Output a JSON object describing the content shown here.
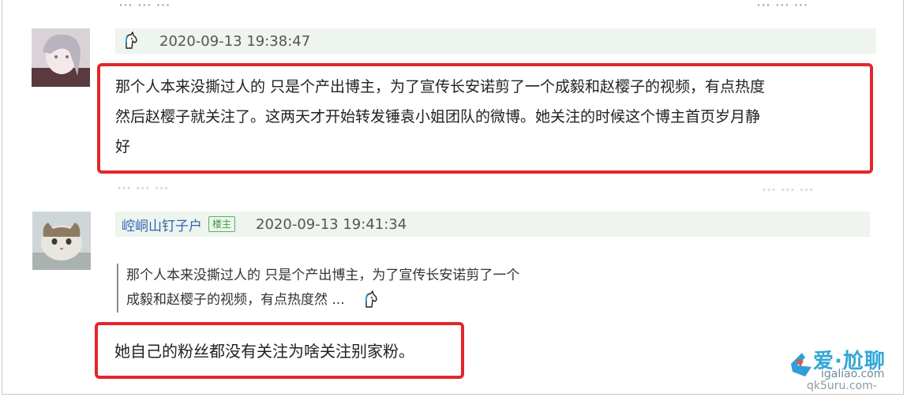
{
  "colors": {
    "accent_red": "#e3262b",
    "username_blue": "#2d64b3",
    "header_bg": "#eef4ee",
    "badge_green": "#3f9a3f"
  },
  "comment1": {
    "time": "2020-09-13 19:38:47",
    "text_lines": [
      "那个人本来没撕过人的 只是个产出博主，为了宣传长安诺剪了一个成毅和赵樱子的视频，有点热度",
      "然后赵樱子就关注了。这两天才开始转发锤袁小姐团队的微博。她关注的时候这个博主首页岁月静",
      "好"
    ],
    "emoji_icon": "unicorn-icon"
  },
  "comment2": {
    "username": "崆峒山钉子户",
    "badge": "楼主",
    "time": "2020-09-13 19:41:34",
    "quote_lines": [
      "那个人本来没撕过人的 只是个产出博主，为了宣传长安诺剪了一个",
      "成毅和赵樱子的视频，有点热度然 ..."
    ],
    "reply": "她自己的粉丝都没有关注为啥关注别家粉。",
    "emoji_icon": "unicorn-icon"
  },
  "watermark": {
    "title": "爱·尬聊",
    "url1": "igaliao.com",
    "url2": "qk5uru.com-"
  }
}
